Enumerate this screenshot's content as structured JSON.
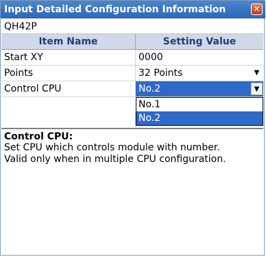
{
  "window": {
    "title": "Input Detailed Configuration Information",
    "close_label": "✕"
  },
  "module": {
    "name": "QH42P"
  },
  "table": {
    "headers": [
      "Item Name",
      "Setting Value"
    ],
    "rows": [
      {
        "item": "Start XY",
        "value": "0000"
      },
      {
        "item": "Points",
        "value": "32 Points"
      },
      {
        "item": "Control CPU",
        "value": "No.2"
      }
    ]
  },
  "dropdown": {
    "options": [
      "No.1",
      "No.2"
    ],
    "selected": "No.2"
  },
  "description": {
    "title": "Control CPU:",
    "lines": [
      "Set CPU which controls module with number.",
      "Valid only when in multiple CPU configuration."
    ]
  },
  "colors": {
    "title_bar": "#2f66b8",
    "selection": "#3169c6",
    "header_bg": "#cfd9ea",
    "header_text": "#1c3f7a",
    "close_button": "#c63a1c"
  }
}
